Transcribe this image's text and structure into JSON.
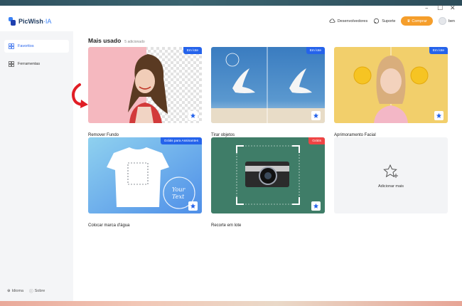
{
  "window": {
    "controls": [
      "–",
      "☐",
      "✕"
    ]
  },
  "app": {
    "name": "PicWish",
    "suffix": "·IA"
  },
  "nav": {
    "developers": "Desenvolvedores",
    "support": "Suporte",
    "buy": "Comprar",
    "user": "ben"
  },
  "sidebar": {
    "items": [
      {
        "label": "Favoritos",
        "icon": "favorites-grid-icon",
        "active": true
      },
      {
        "label": "Ferramentas",
        "icon": "tools-grid-icon",
        "active": false
      }
    ],
    "footer": {
      "language": "Idioma",
      "about": "Sobre"
    }
  },
  "main": {
    "title": "Mais usado",
    "subtitle": "5 adicionado",
    "cards": [
      {
        "label": "Remover Fundo",
        "tag": "Em lote"
      },
      {
        "label": "Tirar objetos",
        "tag": "Em lote"
      },
      {
        "label": "Aprimoramento Facial",
        "tag": "Em lote"
      },
      {
        "label": "Colocar marca d'água",
        "tag": "Grátis para Assinantes"
      },
      {
        "label": "Recorte em lote",
        "tag": "Grátis"
      }
    ],
    "add_card": {
      "label": "Adicionar mais"
    }
  },
  "colors": {
    "accent": "#2563eb",
    "buy": "#f59e2b",
    "free_tag": "#ef4444"
  }
}
